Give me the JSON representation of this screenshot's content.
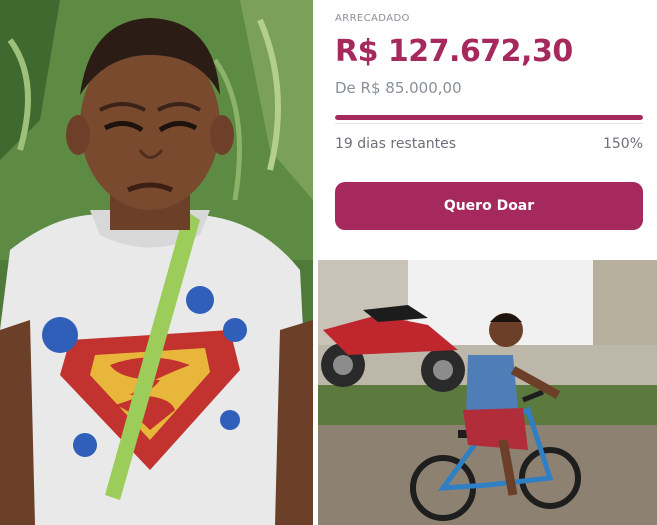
{
  "campaign": {
    "raised_label": "ARRECADADO",
    "raised_amount": "R$ 127.672,30",
    "goal_text": "De R$ 85.000,00",
    "progress_fraction": 1.0,
    "days_remaining": "19 dias restantes",
    "percent": "150%",
    "donate_label": "Quero Doar",
    "accent_color": "#a6295e"
  }
}
